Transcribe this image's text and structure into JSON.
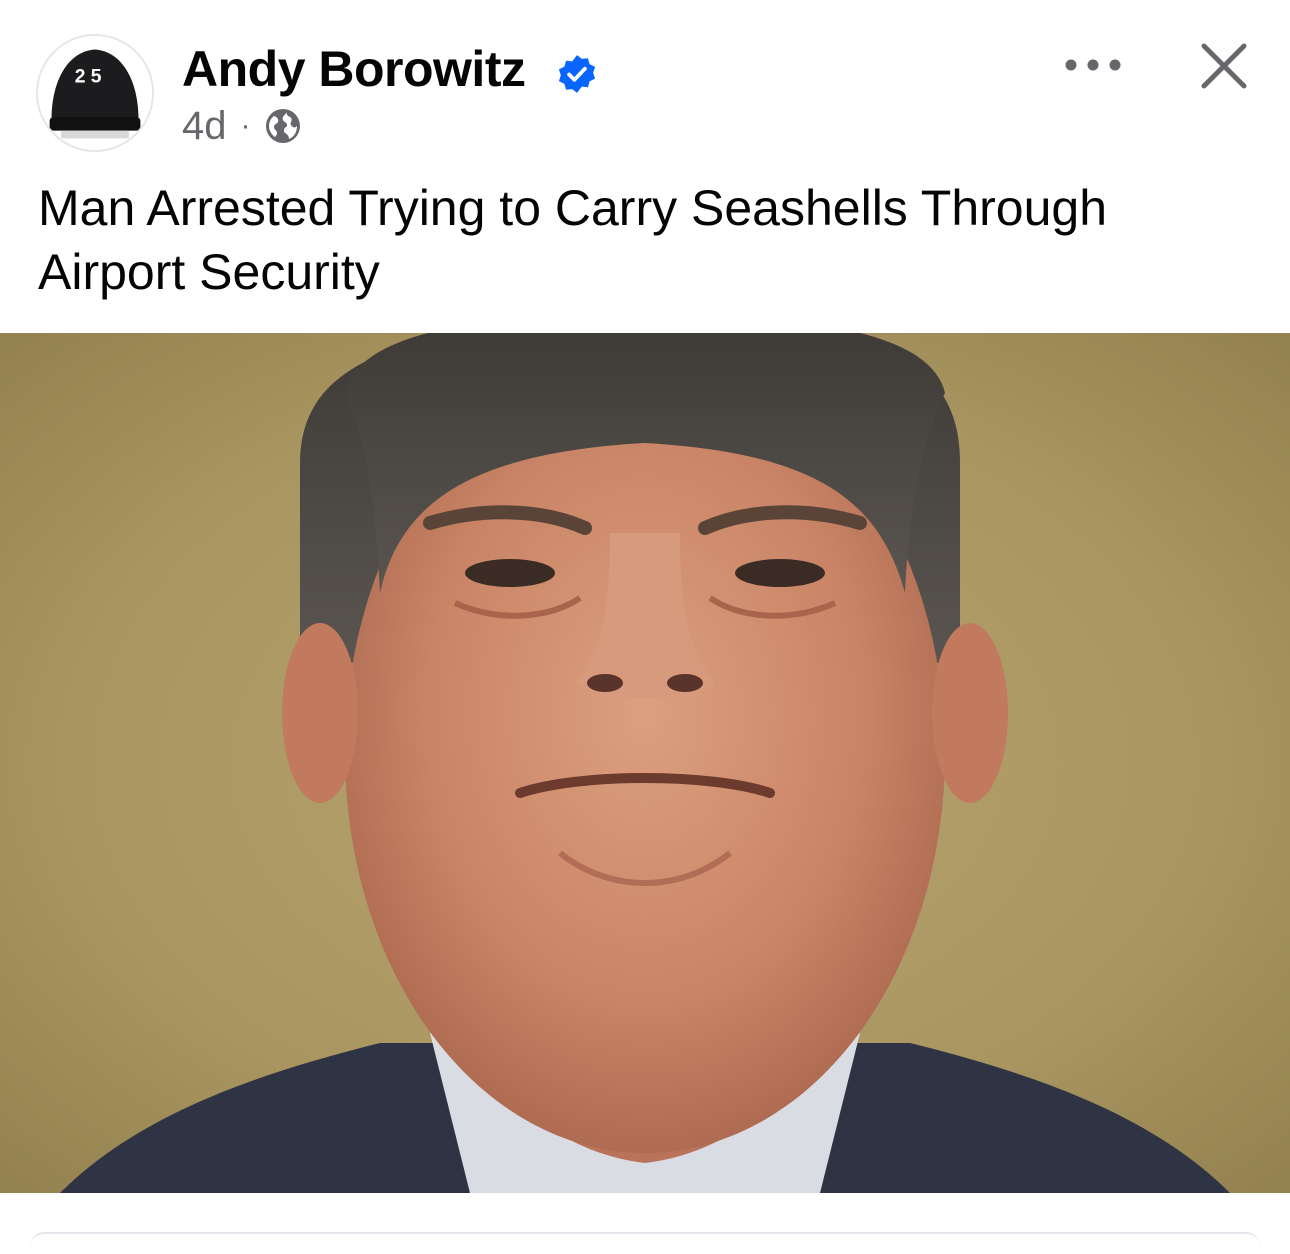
{
  "post": {
    "author": {
      "name": "Andy Borowitz",
      "verified": true,
      "avatar_icon": "black-cap-icon",
      "avatar_text": "2 5"
    },
    "age": "4d",
    "separator": "·",
    "audience_icon": "globe-icon",
    "text": "Man Arrested Trying to Carry Seashells Through Airport Security",
    "photo_icon": "news-photo"
  },
  "header_actions": {
    "more_icon": "more-dots-icon",
    "close_icon": "close-icon"
  },
  "colors": {
    "verified_blue": "#0866ff",
    "secondary_text": "#65676b",
    "primary_text": "#050505"
  }
}
